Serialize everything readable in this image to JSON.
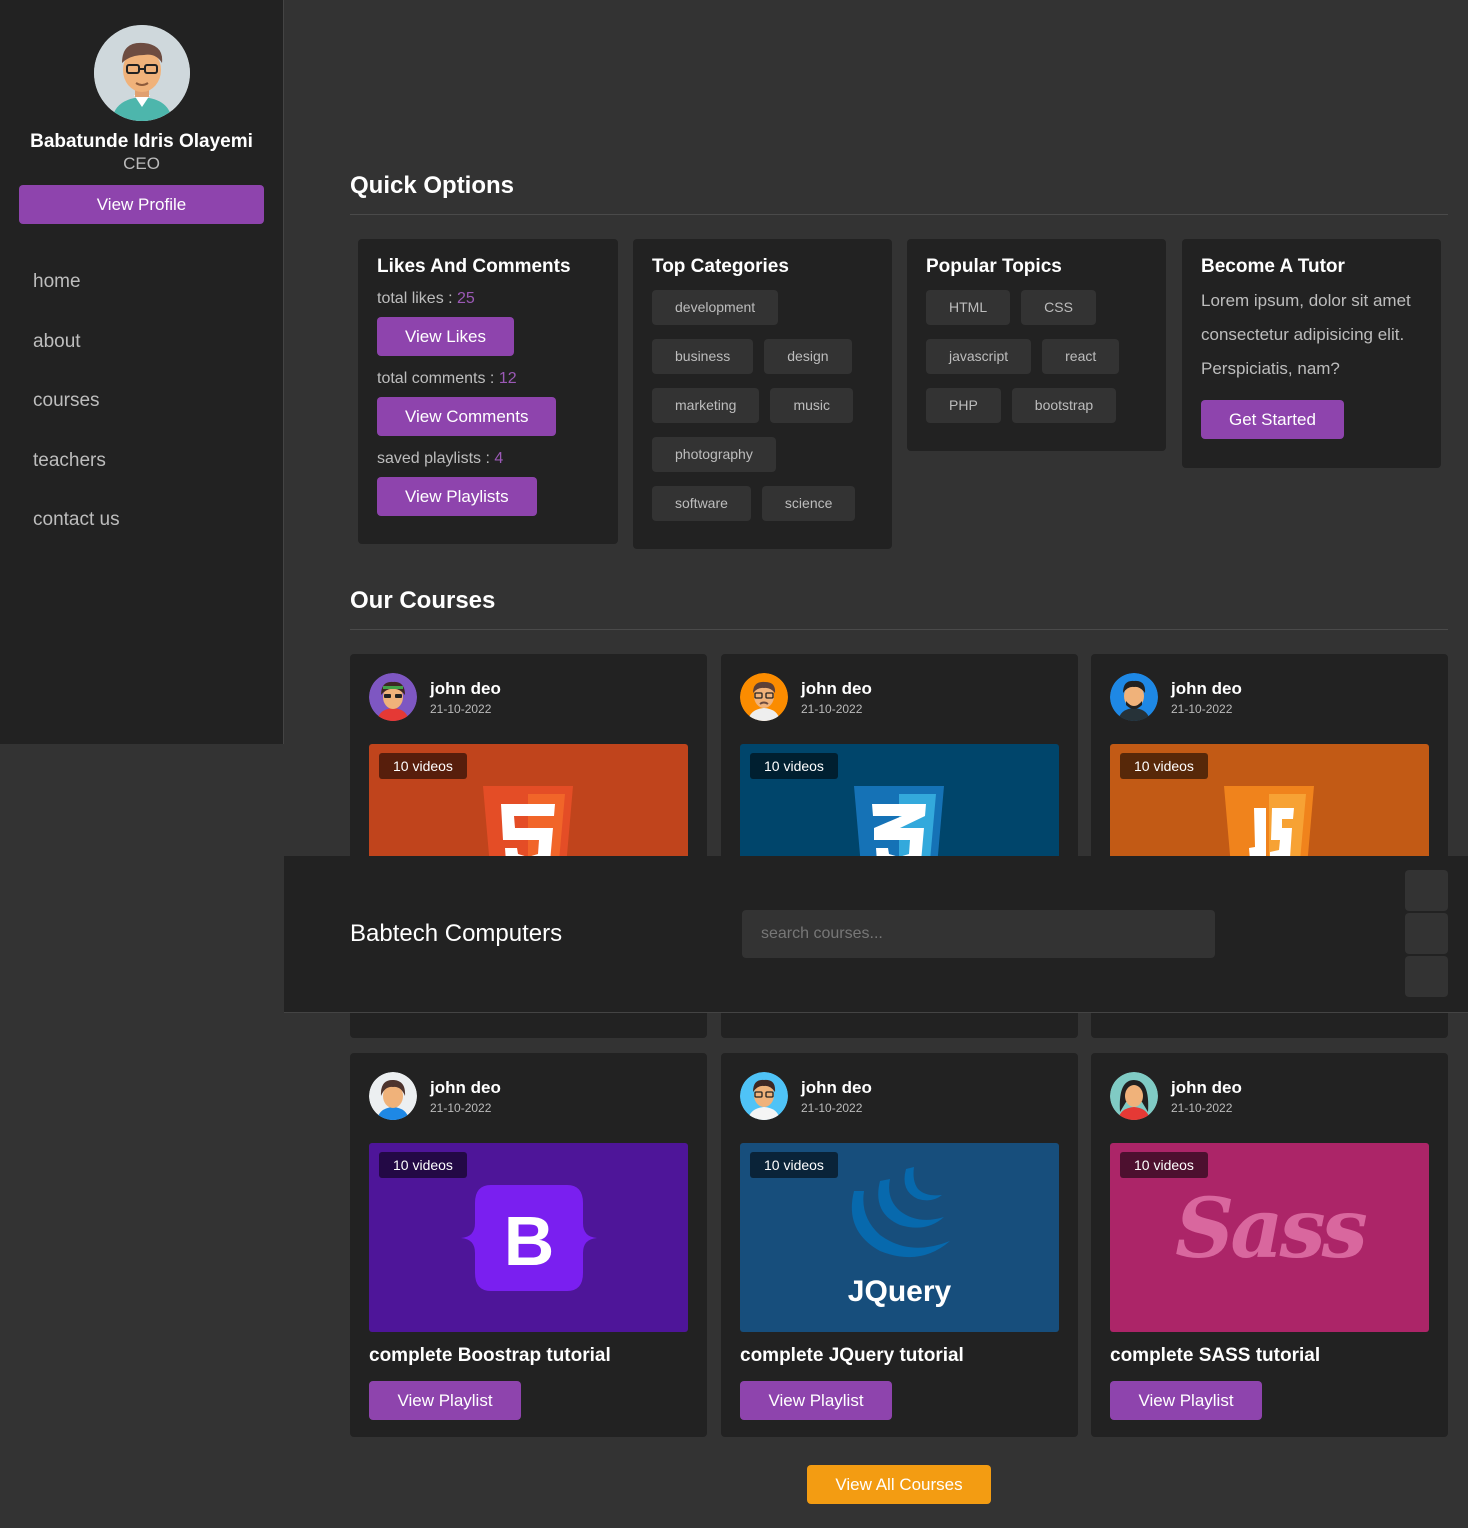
{
  "sidebar": {
    "profile": {
      "name": "Babatunde Idris Olayemi",
      "role": "CEO",
      "button": "View Profile"
    },
    "nav": [
      "home",
      "about",
      "courses",
      "teachers",
      "contact us"
    ]
  },
  "header": {
    "brand": "Babtech Computers",
    "search_placeholder": "search courses..."
  },
  "quick_options": {
    "title": "Quick Options",
    "likes": {
      "title": "Likes And Comments",
      "likes_label": "total likes : ",
      "likes_value": "25",
      "likes_button": "View Likes",
      "comments_label": "total comments : ",
      "comments_value": "12",
      "comments_button": "View Comments",
      "playlists_label": "saved playlists : ",
      "playlists_value": "4",
      "playlists_button": "View Playlists"
    },
    "categories": {
      "title": "Top Categories",
      "tags": [
        "development",
        "business",
        "design",
        "marketing",
        "music",
        "photography",
        "software",
        "science"
      ]
    },
    "topics": {
      "title": "Popular Topics",
      "tags": [
        "HTML",
        "CSS",
        "javascript",
        "react",
        "PHP",
        "bootstrap"
      ]
    },
    "tutor": {
      "title": "Become A Tutor",
      "text": "Lorem ipsum, dolor sit amet consectetur adipisicing elit. Perspiciatis, nam?",
      "button": "Get Started"
    }
  },
  "courses": {
    "title": "Our Courses",
    "items": [
      {
        "tutor": "john deo",
        "date": "21-10-2022",
        "videos": "10 videos",
        "title": "",
        "button": "",
        "color": "#c0441c",
        "logo": "html5-logo"
      },
      {
        "tutor": "john deo",
        "date": "21-10-2022",
        "videos": "10 videos",
        "title": "",
        "button": "",
        "color": "#00456b",
        "logo": "css3-logo"
      },
      {
        "tutor": "john deo",
        "date": "21-10-2022",
        "videos": "10 videos",
        "title": "",
        "button": "",
        "color": "#c25a15",
        "logo": "js-logo"
      },
      {
        "tutor": "john deo",
        "date": "21-10-2022",
        "videos": "10 videos",
        "title": "complete Boostrap tutorial",
        "button": "View Playlist",
        "color": "#4e1599",
        "logo": "bootstrap-logo"
      },
      {
        "tutor": "john deo",
        "date": "21-10-2022",
        "videos": "10 videos",
        "title": "complete JQuery tutorial",
        "button": "View Playlist",
        "color": "#174e7c",
        "logo": "jquery-logo",
        "logo_text": "JQuery"
      },
      {
        "tutor": "john deo",
        "date": "21-10-2022",
        "videos": "10 videos",
        "title": "complete SASS tutorial",
        "button": "View Playlist",
        "color": "#ac2568",
        "logo": "sass-logo",
        "logo_text": "Sass"
      }
    ],
    "view_all": "View All Courses"
  },
  "colors": {
    "accent": "#8e44ad",
    "orange": "#f39c12",
    "panel": "#222222",
    "bg": "#333333"
  }
}
